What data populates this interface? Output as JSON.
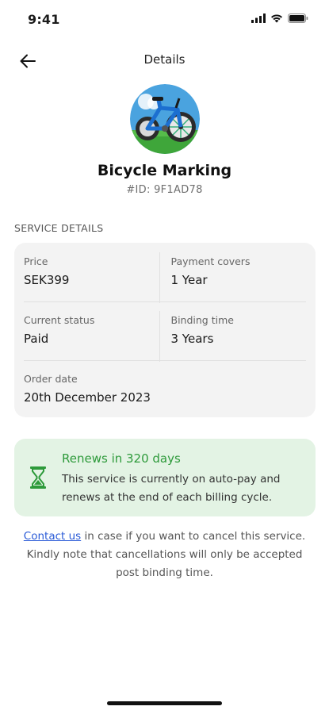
{
  "status_bar": {
    "time": "9:41"
  },
  "nav": {
    "title": "Details",
    "back_icon": "arrow-left-icon"
  },
  "service": {
    "name": "Bicycle Marking",
    "id_label": "#ID: 9F1AD78",
    "image_icon": "bicycle-icon"
  },
  "section": {
    "label": "SERVICE DETAILS"
  },
  "details": {
    "price_label": "Price",
    "price_value": "SEK399",
    "payment_covers_label": "Payment covers",
    "payment_covers_value": "1 Year",
    "status_label": "Current status",
    "status_value": "Paid",
    "binding_label": "Binding time",
    "binding_value": "3 Years",
    "order_date_label": "Order date",
    "order_date_value": "20th December 2023"
  },
  "renewal": {
    "title": "Renews in 320 days",
    "text": "This service is currently on auto-pay and renews at the end of each billing cycle.",
    "icon": "hourglass-icon",
    "accent": "#2e9a3b",
    "background": "#e3f3e4"
  },
  "footer": {
    "link_text": "Contact us",
    "text": " in case if you want to cancel this service. Kindly note that cancellations will only be accepted post binding time."
  }
}
